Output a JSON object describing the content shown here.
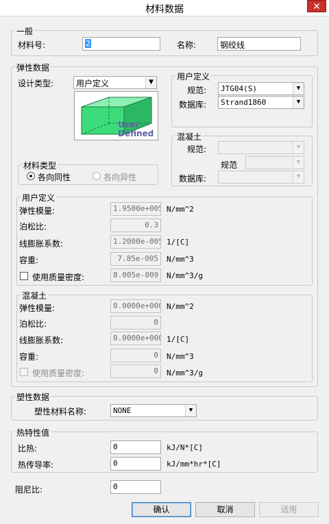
{
  "window": {
    "title": "材料数据",
    "close_glyph": "✕"
  },
  "general": {
    "group_label": "一般",
    "material_no_label": "材料号:",
    "material_no_value": "2",
    "name_label": "名称:",
    "name_value": "钢绞线"
  },
  "elastic": {
    "group_label": "弹性数据",
    "design_type_label": "设计类型:",
    "design_type_value": "用户定义",
    "image_text_line1": "User",
    "image_text_line2": "Defined",
    "material_type": {
      "group_label": "材料类型",
      "isotropic_label": "各向同性",
      "isotropic_selected": true,
      "anisotropic_label": "各向异性"
    },
    "user_defined_db": {
      "group_label": "用户定义",
      "standard_label": "规范:",
      "standard_value": "JTG04(S)",
      "database_label": "数据库:",
      "database_value": "Strand1860"
    },
    "concrete_db": {
      "group_label": "混凝土",
      "standard_label": "规范:",
      "sub_standard_label": "规范",
      "database_label": "数据库:"
    },
    "user_defined_props": {
      "group_label": "用户定义",
      "rows": [
        {
          "label": "弹性模量:",
          "value": "1.9500e+005",
          "unit": "N/mm^2"
        },
        {
          "label": "泊松比:",
          "value": "0.3",
          "unit": ""
        },
        {
          "label": "线膨胀系数:",
          "value": "1.2000e-005",
          "unit": "1/[C]"
        },
        {
          "label": "容重:",
          "value": "7.85e-005",
          "unit": "N/mm^3"
        },
        {
          "label": "使用质量密度:",
          "value": "8.005e-009",
          "unit": "N/mm^3/g",
          "checkbox": true,
          "checked": false
        }
      ]
    },
    "concrete_props": {
      "group_label": "混凝土",
      "rows": [
        {
          "label": "弹性模量:",
          "value": "0.0000e+000",
          "unit": "N/mm^2"
        },
        {
          "label": "泊松比:",
          "value": "0",
          "unit": ""
        },
        {
          "label": "线膨胀系数:",
          "value": "0.0000e+000",
          "unit": "1/[C]"
        },
        {
          "label": "容重:",
          "value": "0",
          "unit": "N/mm^3"
        },
        {
          "label": "使用质量密度:",
          "value": "0",
          "unit": "N/mm^3/g",
          "checkbox": true,
          "checked": false
        }
      ]
    }
  },
  "plastic": {
    "group_label": "塑性数据",
    "name_label": "塑性材料名称:",
    "name_value": "NONE"
  },
  "thermal": {
    "group_label": "热特性值",
    "specific_heat_label": "比热:",
    "specific_heat_value": "0",
    "specific_heat_unit": "kJ/N*[C]",
    "conductivity_label": "热传导率:",
    "conductivity_value": "0",
    "conductivity_unit": "kJ/mm*hr*[C]"
  },
  "damping": {
    "label": "阻尼比:",
    "value": "0"
  },
  "buttons": {
    "ok": "确认",
    "cancel": "取消",
    "apply": "适用"
  },
  "icons": {
    "dropdown": "▼"
  },
  "colors": {
    "accent_selection": "#3399ff",
    "close_button": "#c7312b",
    "box_fill": "#3ddc7a"
  }
}
